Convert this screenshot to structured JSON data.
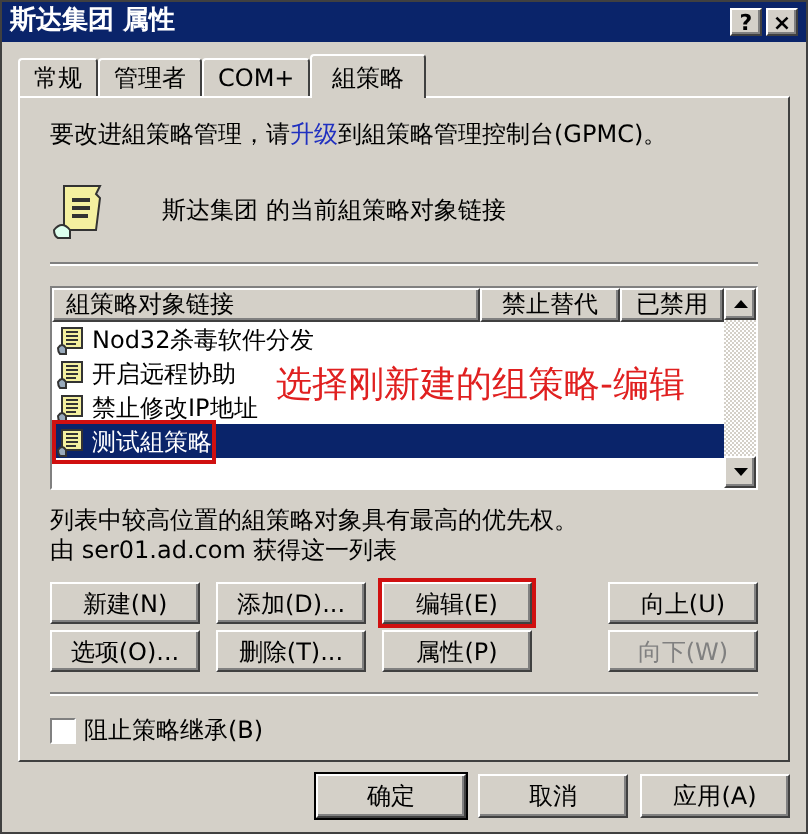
{
  "window": {
    "title": "斯达集团 属性",
    "controls": [
      "?",
      "×"
    ]
  },
  "tabs": [
    {
      "label": "常规",
      "selected": false
    },
    {
      "label": "管理者",
      "selected": false
    },
    {
      "label": "COM+",
      "selected": false
    },
    {
      "label": "組策略",
      "selected": true
    }
  ],
  "upgrade_notice": {
    "before": "要改进組策略管理，请",
    "link": "升级",
    "after": "到組策略管理控制台(GPMC)。"
  },
  "heading": "斯达集团 的当前組策略对象链接",
  "list": {
    "columns": [
      "組策略对象链接",
      "禁止替代",
      "已禁用"
    ],
    "rows": [
      {
        "name": "Nod32杀毒软件分发",
        "selected": false,
        "annotated": false
      },
      {
        "name": "开启远程协助",
        "selected": false,
        "annotated": false
      },
      {
        "name": "禁止修改IP地址",
        "selected": false,
        "annotated": false
      },
      {
        "name": "测试組策略",
        "selected": true,
        "annotated": true
      }
    ]
  },
  "annotation": {
    "text": "选择刚新建的组策略-编辑"
  },
  "priority_note": "列表中较高位置的組策略对象具有最高的优先权。",
  "source_note": "由 ser01.ad.com 获得这一列表",
  "button_rows": [
    [
      {
        "label": "新建(N)",
        "disabled": false,
        "annotated": false
      },
      {
        "label": "添加(D)...",
        "disabled": false,
        "annotated": false
      },
      {
        "label": "编辑(E)",
        "disabled": false,
        "annotated": true
      },
      {
        "label": "向上(U)",
        "disabled": false,
        "annotated": false
      }
    ],
    [
      {
        "label": "选项(O)...",
        "disabled": false,
        "annotated": false
      },
      {
        "label": "删除(T)...",
        "disabled": false,
        "annotated": false
      },
      {
        "label": "属性(P)",
        "disabled": false,
        "annotated": false
      },
      {
        "label": "向下(W)",
        "disabled": true,
        "annotated": false
      }
    ]
  ],
  "block_inheritance": {
    "label": "阻止策略继承(B)",
    "checked": false
  },
  "footer_buttons": [
    {
      "label": "确定",
      "default": true
    },
    {
      "label": "取消",
      "default": false
    },
    {
      "label": "应用(A)",
      "default": false
    }
  ]
}
